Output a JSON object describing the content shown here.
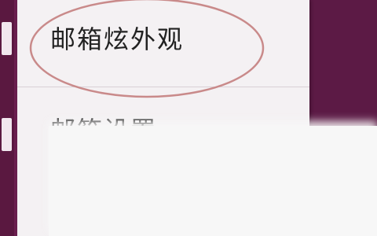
{
  "menu": {
    "items": [
      {
        "label": "邮箱炫外观"
      },
      {
        "label": "邮箱设置"
      }
    ]
  },
  "colors": {
    "accent": "#6b1f4f",
    "annotation": "#c98a8a"
  }
}
